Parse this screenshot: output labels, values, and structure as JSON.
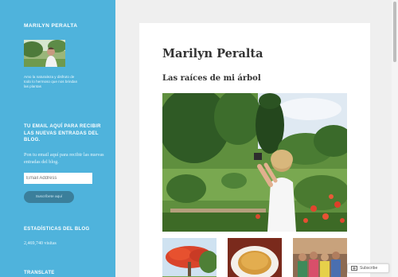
{
  "sidebar": {
    "site_title": "MARILYN PERALTA",
    "bio": "Amo la naturaleza y disfruto de todo lo hermoso que nos brindan las plantas",
    "email_widget": {
      "title": "TU EMAIL AQUÍ PARA RECIBIR LAS NUEVAS ENTRADAS DEL BLOG.",
      "text": "Pon tu email aquí para recibir las nuevas entradas del blog.",
      "placeholder": "Email Address",
      "button_label": "Suscríbete aquí"
    },
    "stats_widget": {
      "title": "ESTADÍSTICAS DEL BLOG",
      "count": "2,469,740 visitas"
    },
    "translate_widget": {
      "title": "TRANSLATE"
    }
  },
  "main": {
    "author": "Marilyn Peralta",
    "post_title": "Las raíces de mi árbol"
  },
  "floating": {
    "subscribe_label": "Subscribe"
  },
  "colors": {
    "sidebar_bg": "#4fb3dc",
    "page_bg": "#efefef",
    "card_bg": "#ffffff",
    "button_bg": "#3b7f9b"
  }
}
